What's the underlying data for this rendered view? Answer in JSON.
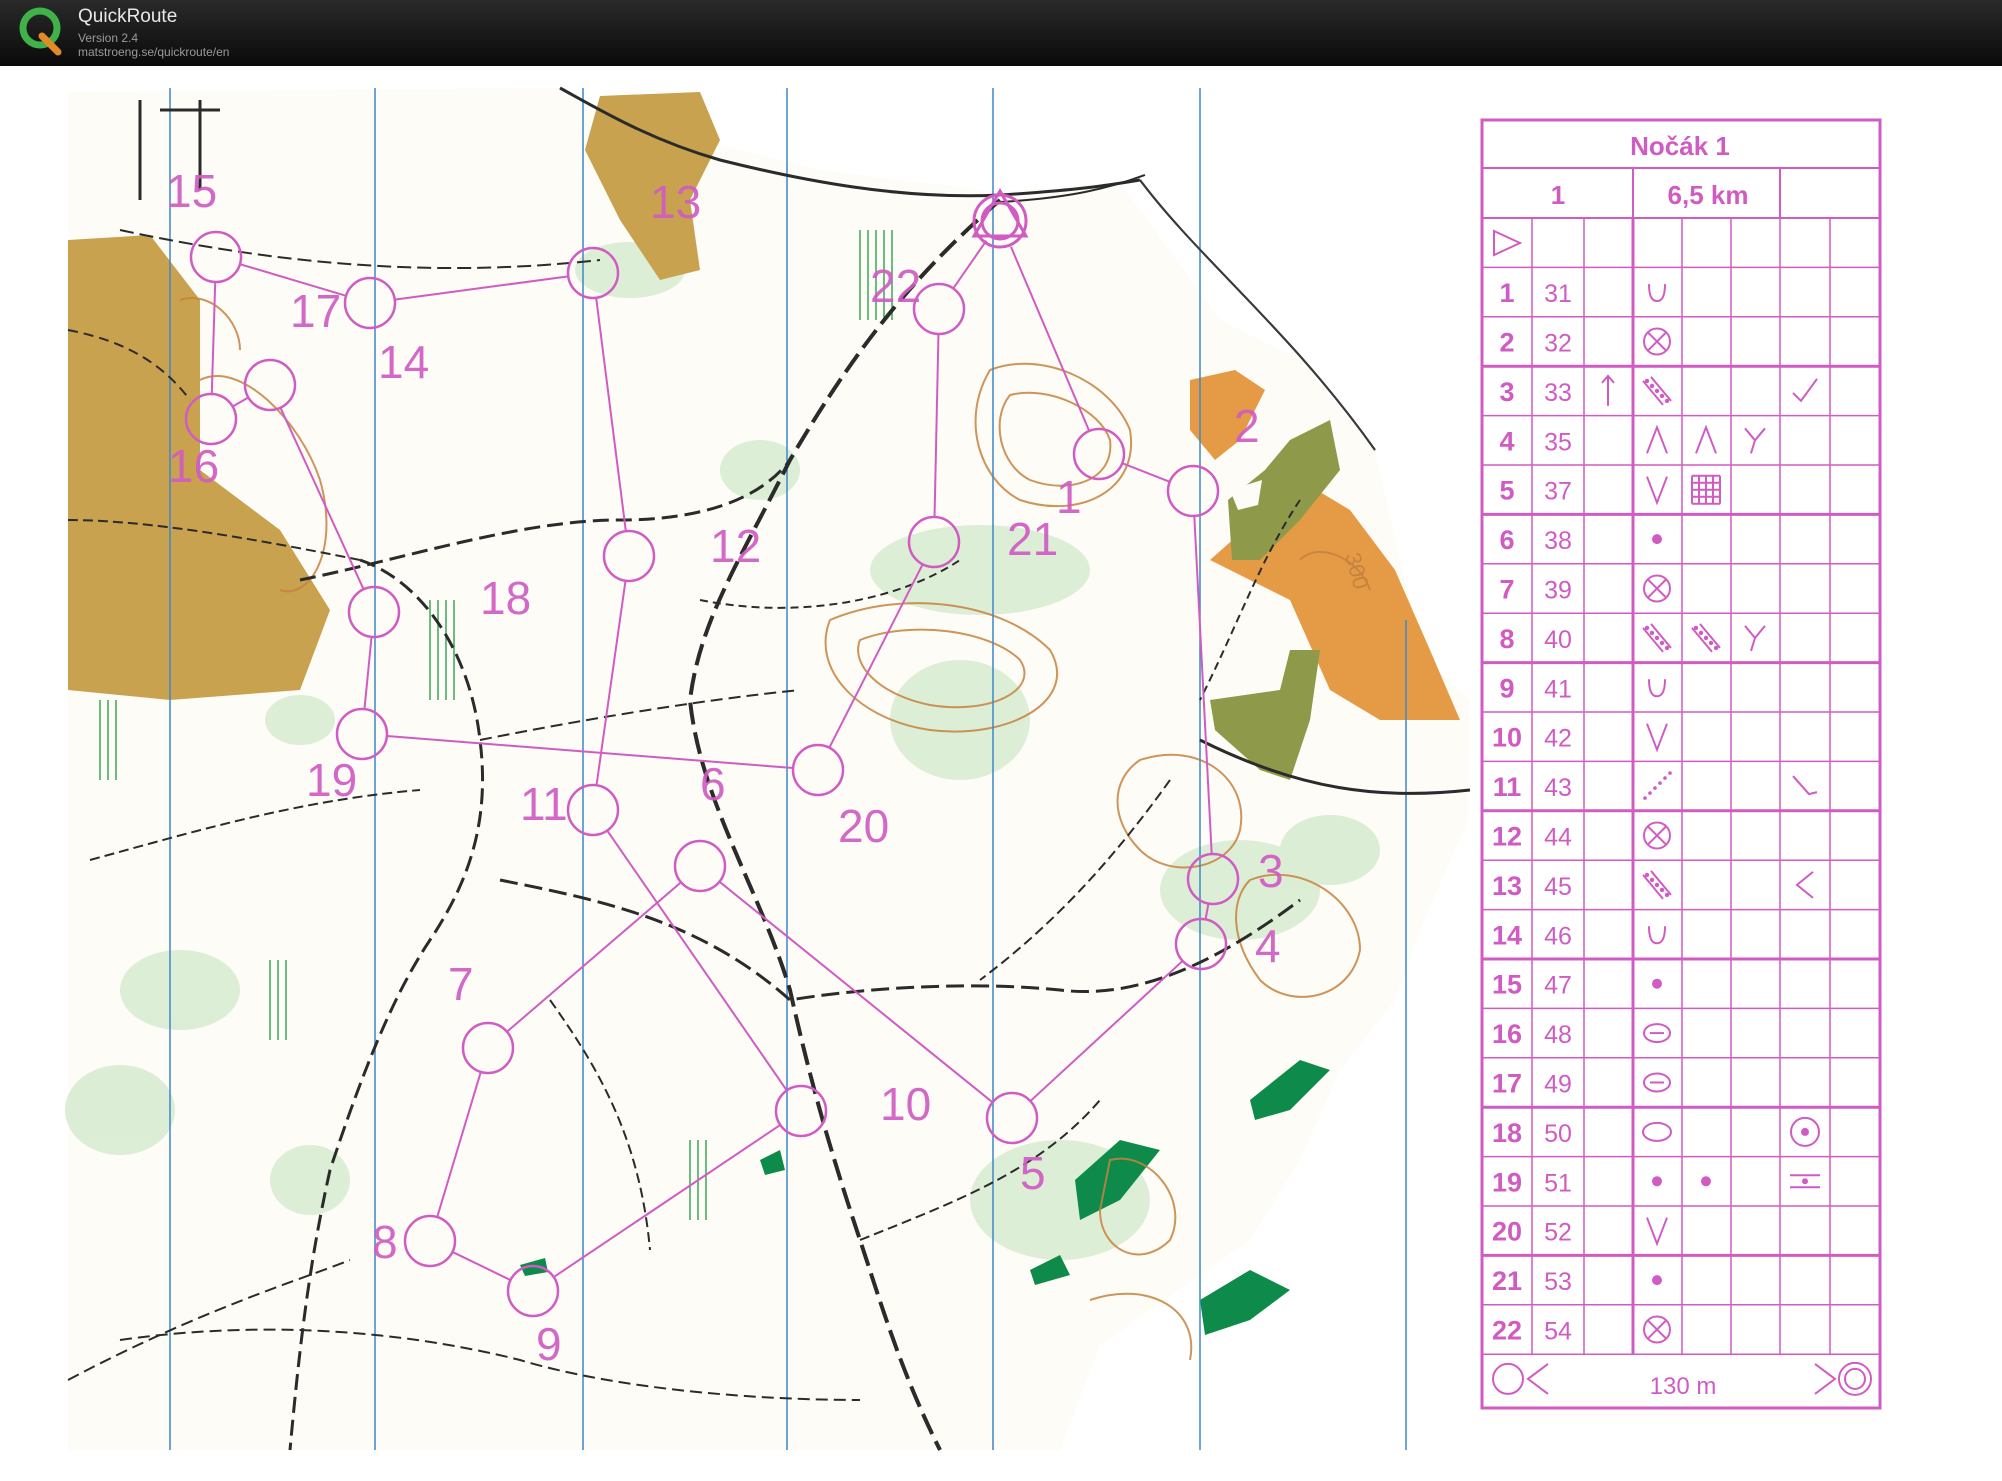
{
  "app": {
    "name": "QuickRoute",
    "version": "Version 2.4",
    "url": "matstroeng.se/quickroute/en"
  },
  "colors": {
    "purple": "#d05cc3",
    "field_yellow": "#c9a24a",
    "orange": "#e49a45",
    "olive": "#8f9a4a",
    "green": "#0e8a4a",
    "contour": "#c6823f",
    "meridian": "#3f86c9",
    "track": "#2b2b2b"
  },
  "map": {
    "contour_value": "300",
    "controls": [
      {
        "n": "1"
      },
      {
        "n": "2"
      },
      {
        "n": "3"
      },
      {
        "n": "4"
      },
      {
        "n": "5"
      },
      {
        "n": "6"
      },
      {
        "n": "7"
      },
      {
        "n": "8"
      },
      {
        "n": "9"
      },
      {
        "n": "10"
      },
      {
        "n": "11"
      },
      {
        "n": "12"
      },
      {
        "n": "13"
      },
      {
        "n": "14"
      },
      {
        "n": "15"
      },
      {
        "n": "16"
      },
      {
        "n": "17"
      },
      {
        "n": "18"
      },
      {
        "n": "19"
      },
      {
        "n": "20"
      },
      {
        "n": "21"
      },
      {
        "n": "22"
      }
    ]
  },
  "description": {
    "title": "Nočák 1",
    "course": "1",
    "length": "6,5 km",
    "rows": [
      {
        "n": "1",
        "code": "31",
        "c": "",
        "d": "depression",
        "e": "",
        "f": "",
        "g": ""
      },
      {
        "n": "2",
        "code": "32",
        "c": "",
        "d": "special-object",
        "e": "",
        "f": "",
        "g": ""
      },
      {
        "n": "3",
        "code": "33",
        "c": "north",
        "d": "stony-ground",
        "e": "",
        "f": "",
        "g": "corner"
      },
      {
        "n": "4",
        "code": "35",
        "c": "",
        "d": "gully",
        "e": "gully",
        "f": "junction",
        "g": ""
      },
      {
        "n": "5",
        "code": "37",
        "c": "",
        "d": "ditch",
        "e": "grid",
        "f": "",
        "g": ""
      },
      {
        "n": "6",
        "code": "38",
        "c": "",
        "d": "dot",
        "e": "",
        "f": "",
        "g": ""
      },
      {
        "n": "7",
        "code": "39",
        "c": "",
        "d": "special-object",
        "e": "",
        "f": "",
        "g": ""
      },
      {
        "n": "8",
        "code": "40",
        "c": "",
        "d": "stony-ground",
        "e": "stony-ground",
        "f": "junction",
        "g": ""
      },
      {
        "n": "9",
        "code": "41",
        "c": "",
        "d": "depression",
        "e": "",
        "f": "",
        "g": ""
      },
      {
        "n": "10",
        "code": "42",
        "c": "",
        "d": "ditch",
        "e": "",
        "f": "",
        "g": ""
      },
      {
        "n": "11",
        "code": "43",
        "c": "",
        "d": "line-feature",
        "e": "",
        "f": "",
        "g": "bend"
      },
      {
        "n": "12",
        "code": "44",
        "c": "",
        "d": "special-object",
        "e": "",
        "f": "",
        "g": ""
      },
      {
        "n": "13",
        "code": "45",
        "c": "",
        "d": "stony-ground",
        "e": "",
        "f": "",
        "g": "left"
      },
      {
        "n": "14",
        "code": "46",
        "c": "",
        "d": "depression",
        "e": "",
        "f": "",
        "g": ""
      },
      {
        "n": "15",
        "code": "47",
        "c": "",
        "d": "dot",
        "e": "",
        "f": "",
        "g": ""
      },
      {
        "n": "16",
        "code": "48",
        "c": "",
        "d": "ellipse-line",
        "e": "",
        "f": "",
        "g": ""
      },
      {
        "n": "17",
        "code": "49",
        "c": "",
        "d": "ellipse-line",
        "e": "",
        "f": "",
        "g": ""
      },
      {
        "n": "18",
        "code": "50",
        "c": "",
        "d": "ellipse",
        "e": "",
        "f": "",
        "g": "circle-dot"
      },
      {
        "n": "19",
        "code": "51",
        "c": "",
        "d": "dot",
        "e": "dot",
        "f": "",
        "g": "between"
      },
      {
        "n": "20",
        "code": "52",
        "c": "",
        "d": "ditch",
        "e": "",
        "f": "",
        "g": ""
      },
      {
        "n": "21",
        "code": "53",
        "c": "",
        "d": "dot",
        "e": "",
        "f": "",
        "g": ""
      },
      {
        "n": "22",
        "code": "54",
        "c": "",
        "d": "special-object",
        "e": "",
        "f": "",
        "g": ""
      }
    ],
    "finish_distance": "130 m"
  }
}
